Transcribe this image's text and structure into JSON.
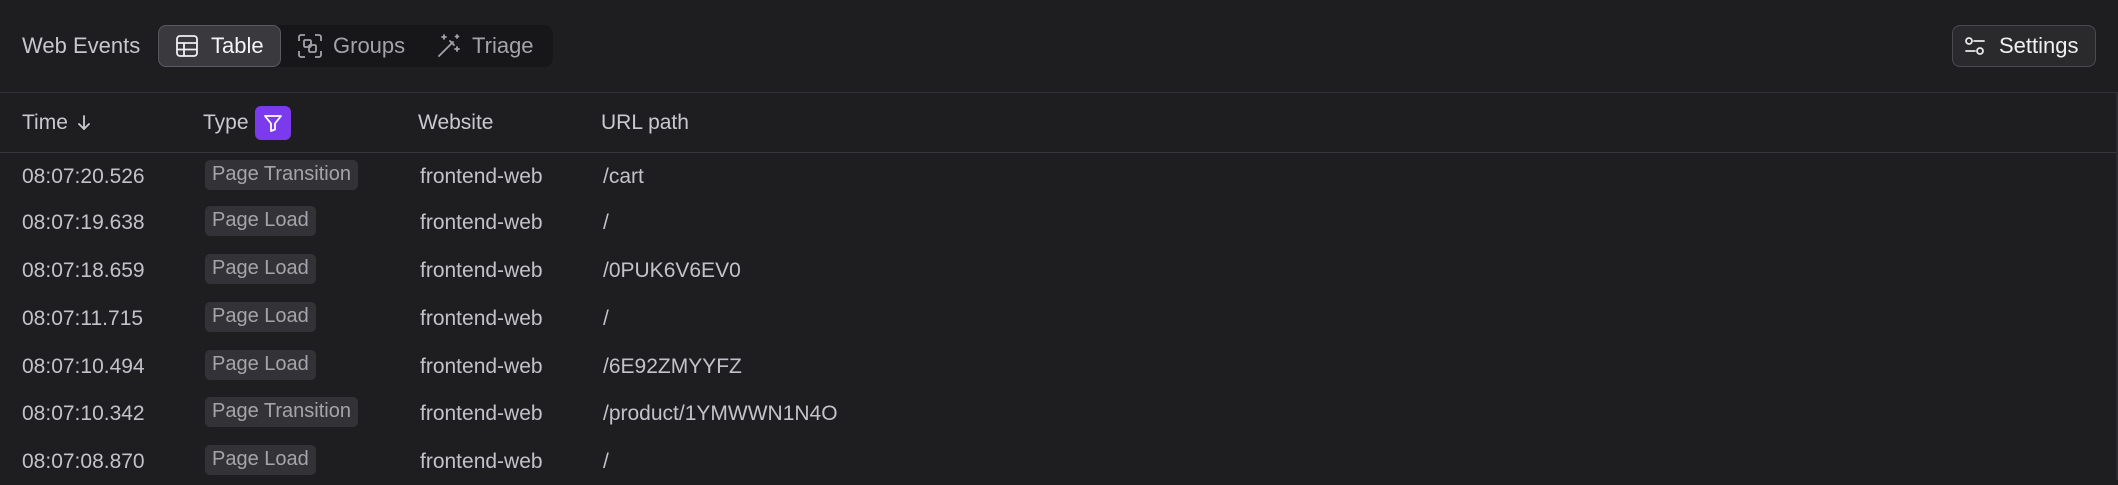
{
  "header": {
    "title": "Web Events",
    "tabs": [
      {
        "label": "Table",
        "icon": "table-icon",
        "active": true
      },
      {
        "label": "Groups",
        "icon": "groups-icon",
        "active": false
      },
      {
        "label": "Triage",
        "icon": "magic-wand-icon",
        "active": false
      }
    ],
    "settings_label": "Settings",
    "settings_icon": "sliders-icon"
  },
  "table": {
    "columns": [
      {
        "label": "Time",
        "sort": "descending"
      },
      {
        "label": "Type",
        "filter_active": true
      },
      {
        "label": "Website"
      },
      {
        "label": "URL path"
      }
    ],
    "rows": [
      {
        "time": "08:07:20.526",
        "type": "Page Transition",
        "website": "frontend-web",
        "path": "/cart"
      },
      {
        "time": "08:07:19.638",
        "type": "Page Load",
        "website": "frontend-web",
        "path": "/"
      },
      {
        "time": "08:07:18.659",
        "type": "Page Load",
        "website": "frontend-web",
        "path": "/0PUK6V6EV0"
      },
      {
        "time": "08:07:11.715",
        "type": "Page Load",
        "website": "frontend-web",
        "path": "/"
      },
      {
        "time": "08:07:10.494",
        "type": "Page Load",
        "website": "frontend-web",
        "path": "/6E92ZMYYFZ"
      },
      {
        "time": "08:07:10.342",
        "type": "Page Transition",
        "website": "frontend-web",
        "path": "/product/1YMWWN1N4O"
      },
      {
        "time": "08:07:08.870",
        "type": "Page Load",
        "website": "frontend-web",
        "path": "/"
      }
    ]
  },
  "colors": {
    "background": "#1e1e21",
    "accent_filter": "#7c3aed",
    "badge_bg": "#333337"
  }
}
